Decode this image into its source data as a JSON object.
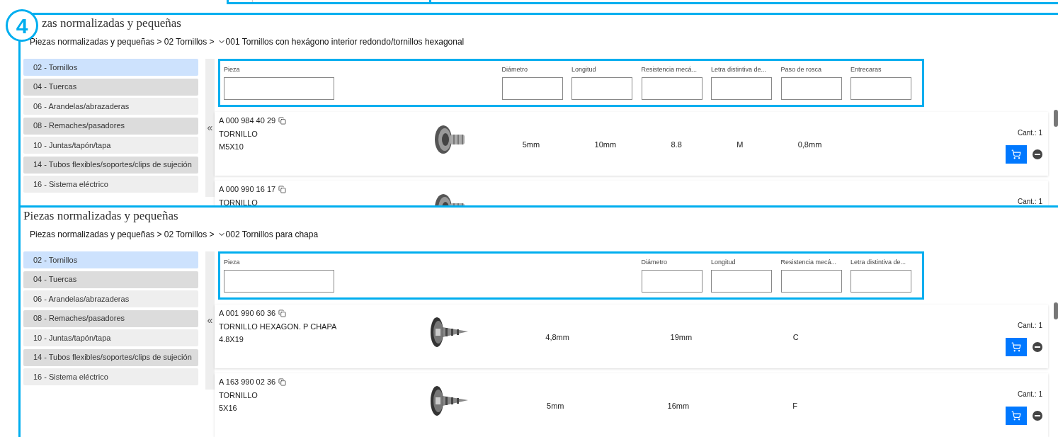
{
  "callout": {
    "number": "4"
  },
  "panels": [
    {
      "title": "zas normalizadas y pequeñas",
      "breadcrumb": {
        "path": "Piezas normalizadas y pequeñas > 02 Tornillos >",
        "current": "001 Tornillos con hexágono interior redondo/tornillos hexagonal"
      },
      "categories": [
        {
          "label": "02 - Tornillos",
          "selected": true
        },
        {
          "label": "04 - Tuercas",
          "selected": false
        },
        {
          "label": "06 - Arandelas/abrazaderas",
          "selected": false
        },
        {
          "label": "08 - Remaches/pasadores",
          "selected": false
        },
        {
          "label": "10 - Juntas/tapón/tapa",
          "selected": false
        },
        {
          "label": "14 - Tubos flexibles/soportes/clips de sujeción",
          "selected": false
        },
        {
          "label": "16 - Sistema eléctrico",
          "selected": false
        }
      ],
      "collapse": "«",
      "filters": [
        {
          "label": "Pieza"
        },
        {
          "label": "Diámetro"
        },
        {
          "label": "Longitud"
        },
        {
          "label": "Resistencia mecá..."
        },
        {
          "label": "Letra distintiva de..."
        },
        {
          "label": "Paso de rosca"
        },
        {
          "label": "Entrecaras"
        }
      ],
      "products": [
        {
          "part_number": "A 000 984 40 29",
          "name": "TORNILLO",
          "spec": "M5X10",
          "kind": "bolt",
          "values": [
            "5mm",
            "10mm",
            "8.8",
            "M",
            "0,8mm"
          ],
          "quantity": "Cant.: 1"
        },
        {
          "part_number": "A 000 990 16 17",
          "name": "TORNILLO",
          "kind": "bolt",
          "quantity": "Cant.: 1"
        }
      ]
    },
    {
      "title": "Piezas normalizadas y pequeñas",
      "breadcrumb": {
        "path": "Piezas normalizadas y pequeñas > 02 Tornillos >",
        "current": "002 Tornillos para chapa"
      },
      "categories": [
        {
          "label": "02 - Tornillos",
          "selected": true
        },
        {
          "label": "04 - Tuercas",
          "selected": false
        },
        {
          "label": "06 - Arandelas/abrazaderas",
          "selected": false
        },
        {
          "label": "08 - Remaches/pasadores",
          "selected": false
        },
        {
          "label": "10 - Juntas/tapón/tapa",
          "selected": false
        },
        {
          "label": "14 - Tubos flexibles/soportes/clips de sujeción",
          "selected": false
        },
        {
          "label": "16 - Sistema eléctrico",
          "selected": false
        }
      ],
      "collapse": "«",
      "filters": [
        {
          "label": "Pieza"
        },
        {
          "label": "Diámetro"
        },
        {
          "label": "Longitud"
        },
        {
          "label": "Resistencia mecá..."
        },
        {
          "label": "Letra distintiva de..."
        }
      ],
      "products": [
        {
          "part_number": "A 001 990 60 36",
          "name": "TORNILLO HEXAGON. P CHAPA",
          "spec": "4.8X19",
          "kind": "tapping",
          "values": [
            "4,8mm",
            "19mm",
            "C"
          ],
          "quantity": "Cant.: 1"
        },
        {
          "part_number": "A 163 990 02 36",
          "name": "TORNILLO",
          "spec": "5X16",
          "kind": "tapping",
          "values": [
            "5mm",
            "16mm",
            "F"
          ],
          "quantity": "Cant.: 1"
        }
      ]
    }
  ]
}
